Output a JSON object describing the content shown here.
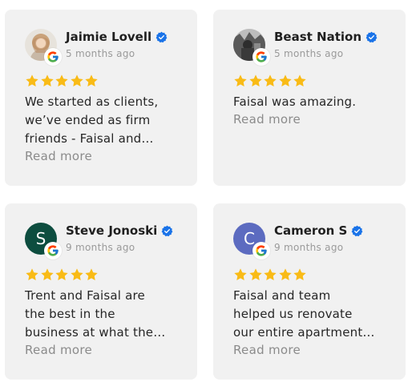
{
  "reviews": [
    {
      "name": "Jaimie Lovell",
      "date": "5 months ago",
      "rating": 5,
      "text_lines": [
        "We started as clients,",
        "we’ve ended as firm",
        "friends - Faisal and…"
      ],
      "read_more": "Read more",
      "avatar_type": "photo",
      "avatar_initial": "",
      "avatar_color": "#d9b99a"
    },
    {
      "name": "Beast Nation",
      "date": "5 months ago",
      "rating": 5,
      "text_lines": [
        "Faisal was amazing."
      ],
      "read_more": "Read more",
      "avatar_type": "photo",
      "avatar_initial": "",
      "avatar_color": "#7b7b7b"
    },
    {
      "name": "Steve Jonoski",
      "date": "9 months ago",
      "rating": 5,
      "text_lines": [
        "Trent and Faisal are",
        "the best in the",
        "business at what the…"
      ],
      "read_more": "Read more",
      "avatar_type": "initial",
      "avatar_initial": "S",
      "avatar_color": "#0d4d3f"
    },
    {
      "name": "Cameron S",
      "date": "9 months ago",
      "rating": 5,
      "text_lines": [
        "Faisal and team",
        "helped us renovate",
        "our entire apartment…"
      ],
      "read_more": "Read more",
      "avatar_type": "initial",
      "avatar_initial": "C",
      "avatar_color": "#5c6bc0"
    }
  ],
  "colors": {
    "star": "#f9bb16",
    "verified": "#1a73e8",
    "card_bg": "#f1f1f1"
  },
  "icons": {
    "verified": "verified-check-icon",
    "source": "google-g-icon",
    "star": "star-icon"
  }
}
